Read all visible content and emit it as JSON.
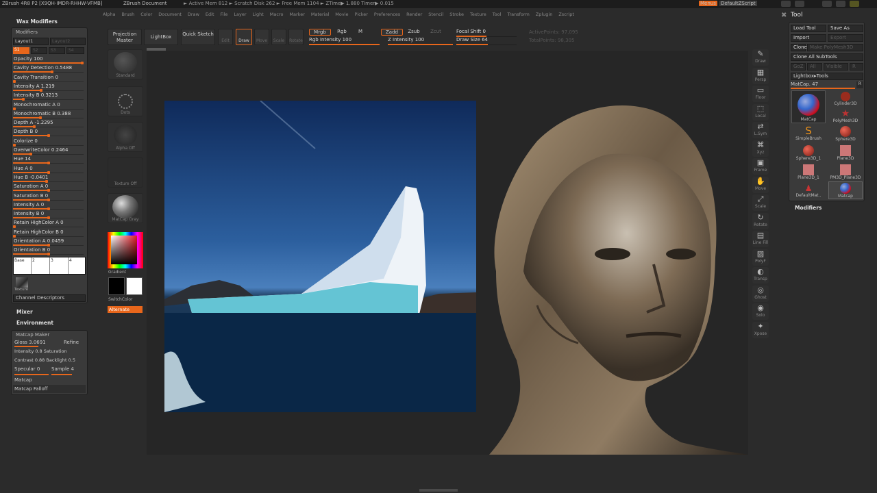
{
  "titlebar": {
    "app": "ZBrush 4R8 P2 [X9QH-IMDR-RHHW-VFMB]",
    "document": "ZBrush Document",
    "stats": "► Active Mem 812 ► Scratch Disk 262 ► Free Mem 1104 ► ZTime▶ 1.880 Timer▶ 0.015",
    "menus_label": "Menus",
    "zscript_label": "DefaultZScript"
  },
  "menubar": [
    "Alpha",
    "Brush",
    "Color",
    "Document",
    "Draw",
    "Edit",
    "File",
    "Layer",
    "Light",
    "Macro",
    "Marker",
    "Material",
    "Movie",
    "Picker",
    "Preferences",
    "Render",
    "Stencil",
    "Stroke",
    "Texture",
    "Tool",
    "Transform",
    "Zplugin",
    "Zscript"
  ],
  "left_palette": {
    "title": "Wax Modifiers",
    "modifiers_header": "Modifiers",
    "layout_label": "Layout1",
    "layout_right": "Layout2",
    "s1_label": "S1",
    "s2_label": "S2",
    "s3_label": "S3",
    "s4_label": "S4",
    "sliders": [
      {
        "label": "Opacity 100",
        "fill": 1.0
      },
      {
        "label": "Cavity Detection 0.5488",
        "fill": 0.55
      },
      {
        "label": "Cavity Transition 0",
        "fill": 0.0
      },
      {
        "label": "Intensity A 1.219",
        "fill": 0.4
      },
      {
        "label": "Intensity B 0.3213",
        "fill": 0.15
      },
      {
        "label": "Monochromatic A 0",
        "fill": 0.0
      },
      {
        "label": "Monochromatic B 0.388",
        "fill": 0.39
      },
      {
        "label": "Depth A -1.2295",
        "fill": 0.3
      },
      {
        "label": "Depth B 0",
        "fill": 0.5
      },
      {
        "label": "Colorize 0",
        "fill": 0.0
      },
      {
        "label": "OverwriteColor 0.2464",
        "fill": 0.25
      },
      {
        "label": "Hue 14",
        "fill": 0.5
      },
      {
        "label": "Hue A 0",
        "fill": 0.5
      },
      {
        "label": "Hue B -0.0401",
        "fill": 0.48
      },
      {
        "label": "Saturation A 0",
        "fill": 0.5
      },
      {
        "label": "Saturation B 0",
        "fill": 0.5
      },
      {
        "label": "Intensity A 0",
        "fill": 0.5
      },
      {
        "label": "Intensity B 0",
        "fill": 0.5
      },
      {
        "label": "Retain HighColor A 0",
        "fill": 0.0
      },
      {
        "label": "Retain HighColor B 0",
        "fill": 0.0
      },
      {
        "label": "Orientation A 0.0459",
        "fill": 0.5
      },
      {
        "label": "Orientation B 0",
        "fill": 0.5
      }
    ],
    "curve_cells": [
      "Base",
      "2",
      "3",
      "4"
    ],
    "texture_label": "Texture",
    "channel_descriptors": "Channel Descriptors",
    "mixer": "Mixer",
    "environment": "Environment",
    "matcap_maker": "Matcap Maker",
    "gloss": "Gloss 3.0691",
    "refine": "Refine",
    "intensity_sat": "Intensity 0.8  Saturation",
    "contrast_backlight": "Contrast 0.88  Backlight 0.5",
    "specular": "Specular 0",
    "sample": "Sample 4",
    "matcap": "Matcap",
    "matcap_falloff": "Matcap Falloff"
  },
  "shelf": {
    "projection_master": "Projection Master",
    "lightbox": "LightBox",
    "quick_sketch": "Quick Sketch",
    "edit": "Edit",
    "draw": "Draw",
    "move": "Move",
    "scale": "Scale",
    "rotate": "Rotate",
    "mrgb": "Mrgb",
    "rgb": "Rgb",
    "m": "M",
    "zadd": "Zadd",
    "zsub": "Zsub",
    "zcut": "Zcut",
    "focal_shift": "Focal Shift 0",
    "rgb_intensity": "Rgb Intensity 100",
    "z_intensity": "Z Intensity 100",
    "draw_size": "Draw Size 64",
    "active_points": "ActivePoints: 97,095",
    "total_points": "TotalPoints: 98,305"
  },
  "tool_strip": {
    "brush": "Standard",
    "stroke": "Dots",
    "alpha": "Alpha Off",
    "texture": "Texture Off",
    "material": "MatCap Gray",
    "gradient": "Gradient",
    "switch_color": "SwitchColor",
    "alternate": "Alternate"
  },
  "right_shelf": [
    "Draw",
    "Persp",
    "Floor",
    "Local",
    "L.Sym",
    "Xyz",
    "Frame",
    "Move",
    "Scale",
    "Rotate",
    "Line Fill",
    "PolyF",
    "Transp",
    "Ghost",
    "Solo",
    "Xpose"
  ],
  "tool_palette": {
    "title": "Tool",
    "load_tool": "Load Tool",
    "save_as": "Save As",
    "import": "Import",
    "export": "Export",
    "clone": "Clone",
    "make_polymesh": "Make PolyMesh3D",
    "goz": "GoZ",
    "all": "All",
    "visible": "Visible",
    "r": "R",
    "clone_all": "Clone All SubTools",
    "lightbox_tools": "Lightbox▸Tools",
    "matcap_slider": "MatCap. 47",
    "tiles": [
      "MatCap",
      "Cylinder3D",
      "PolyMesh3D",
      "SimpleBrush",
      "Sphere3D",
      "Sphere3D_1",
      "Plane3D",
      "Plane3D_1",
      "PM3D_Plane3D",
      "DefaultMat..",
      "Matcap"
    ],
    "modifiers": "Modifiers"
  },
  "colors": {
    "accent": "#e8661b",
    "panel": "#3a3a3a",
    "background": "#2b2b2b"
  }
}
